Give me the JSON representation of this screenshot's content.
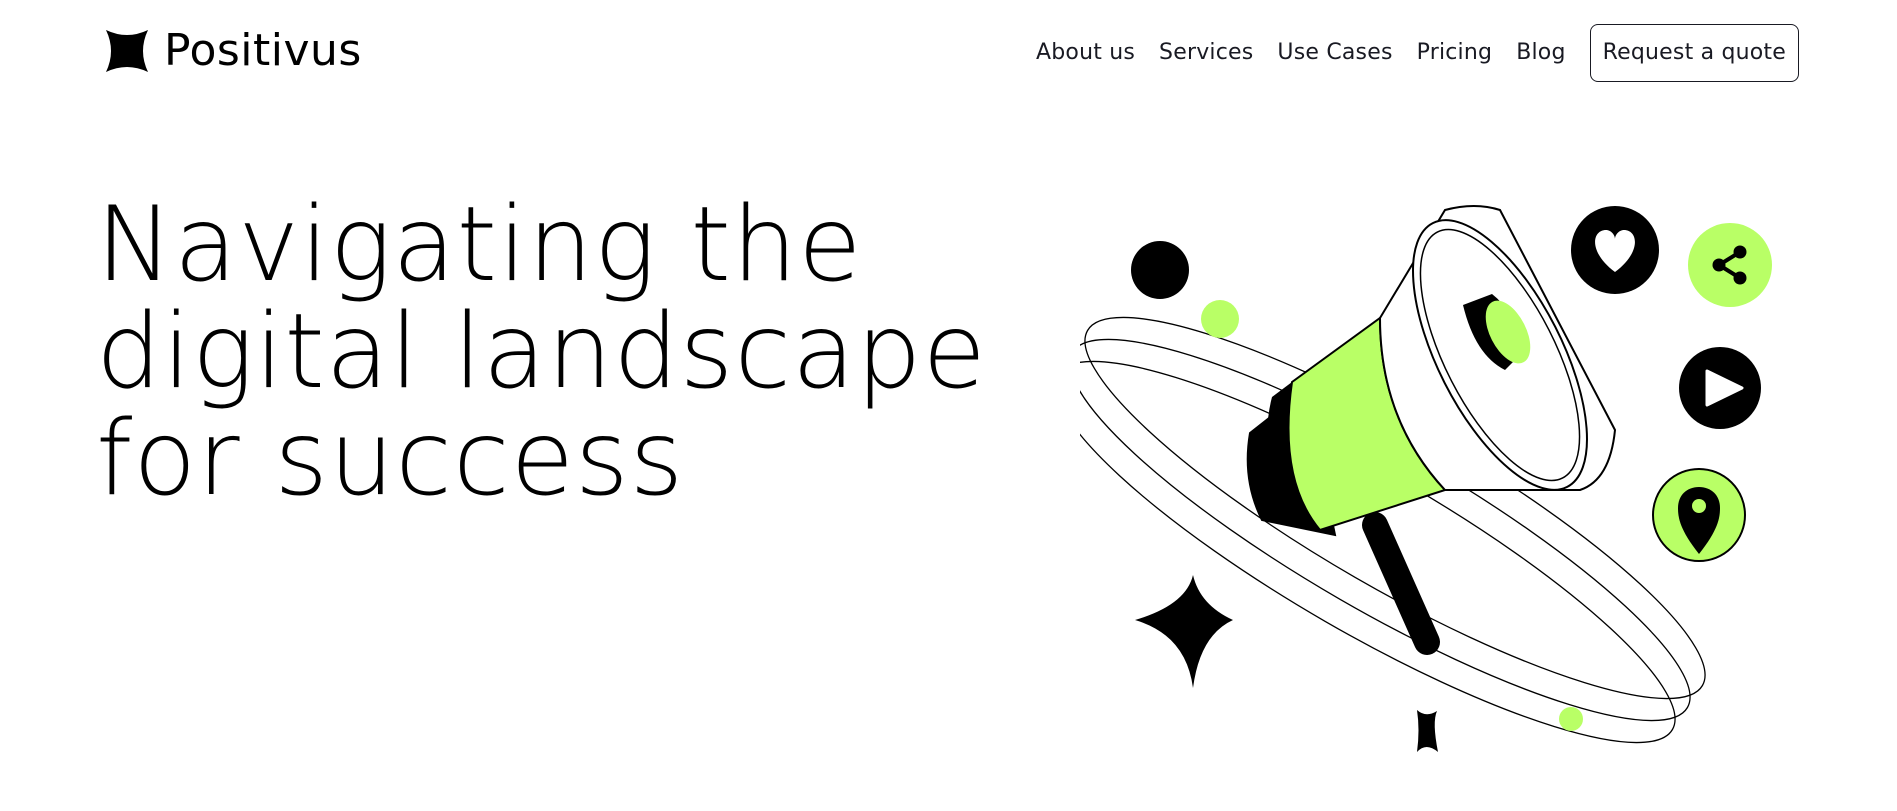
{
  "brand": {
    "name": "Positivus",
    "accent": "#B9FF66",
    "dark": "#191A23"
  },
  "nav": {
    "links": [
      "About us",
      "Services",
      "Use Cases",
      "Pricing",
      "Blog"
    ],
    "cta": "Request a quote"
  },
  "hero": {
    "title_lines": [
      "Navigating the",
      "digital landscape",
      "for success"
    ]
  },
  "illustration": {
    "icons": [
      "megaphone-icon",
      "heart-icon",
      "share-icon",
      "play-icon",
      "location-pin-icon",
      "sparkle-star-icon"
    ]
  }
}
